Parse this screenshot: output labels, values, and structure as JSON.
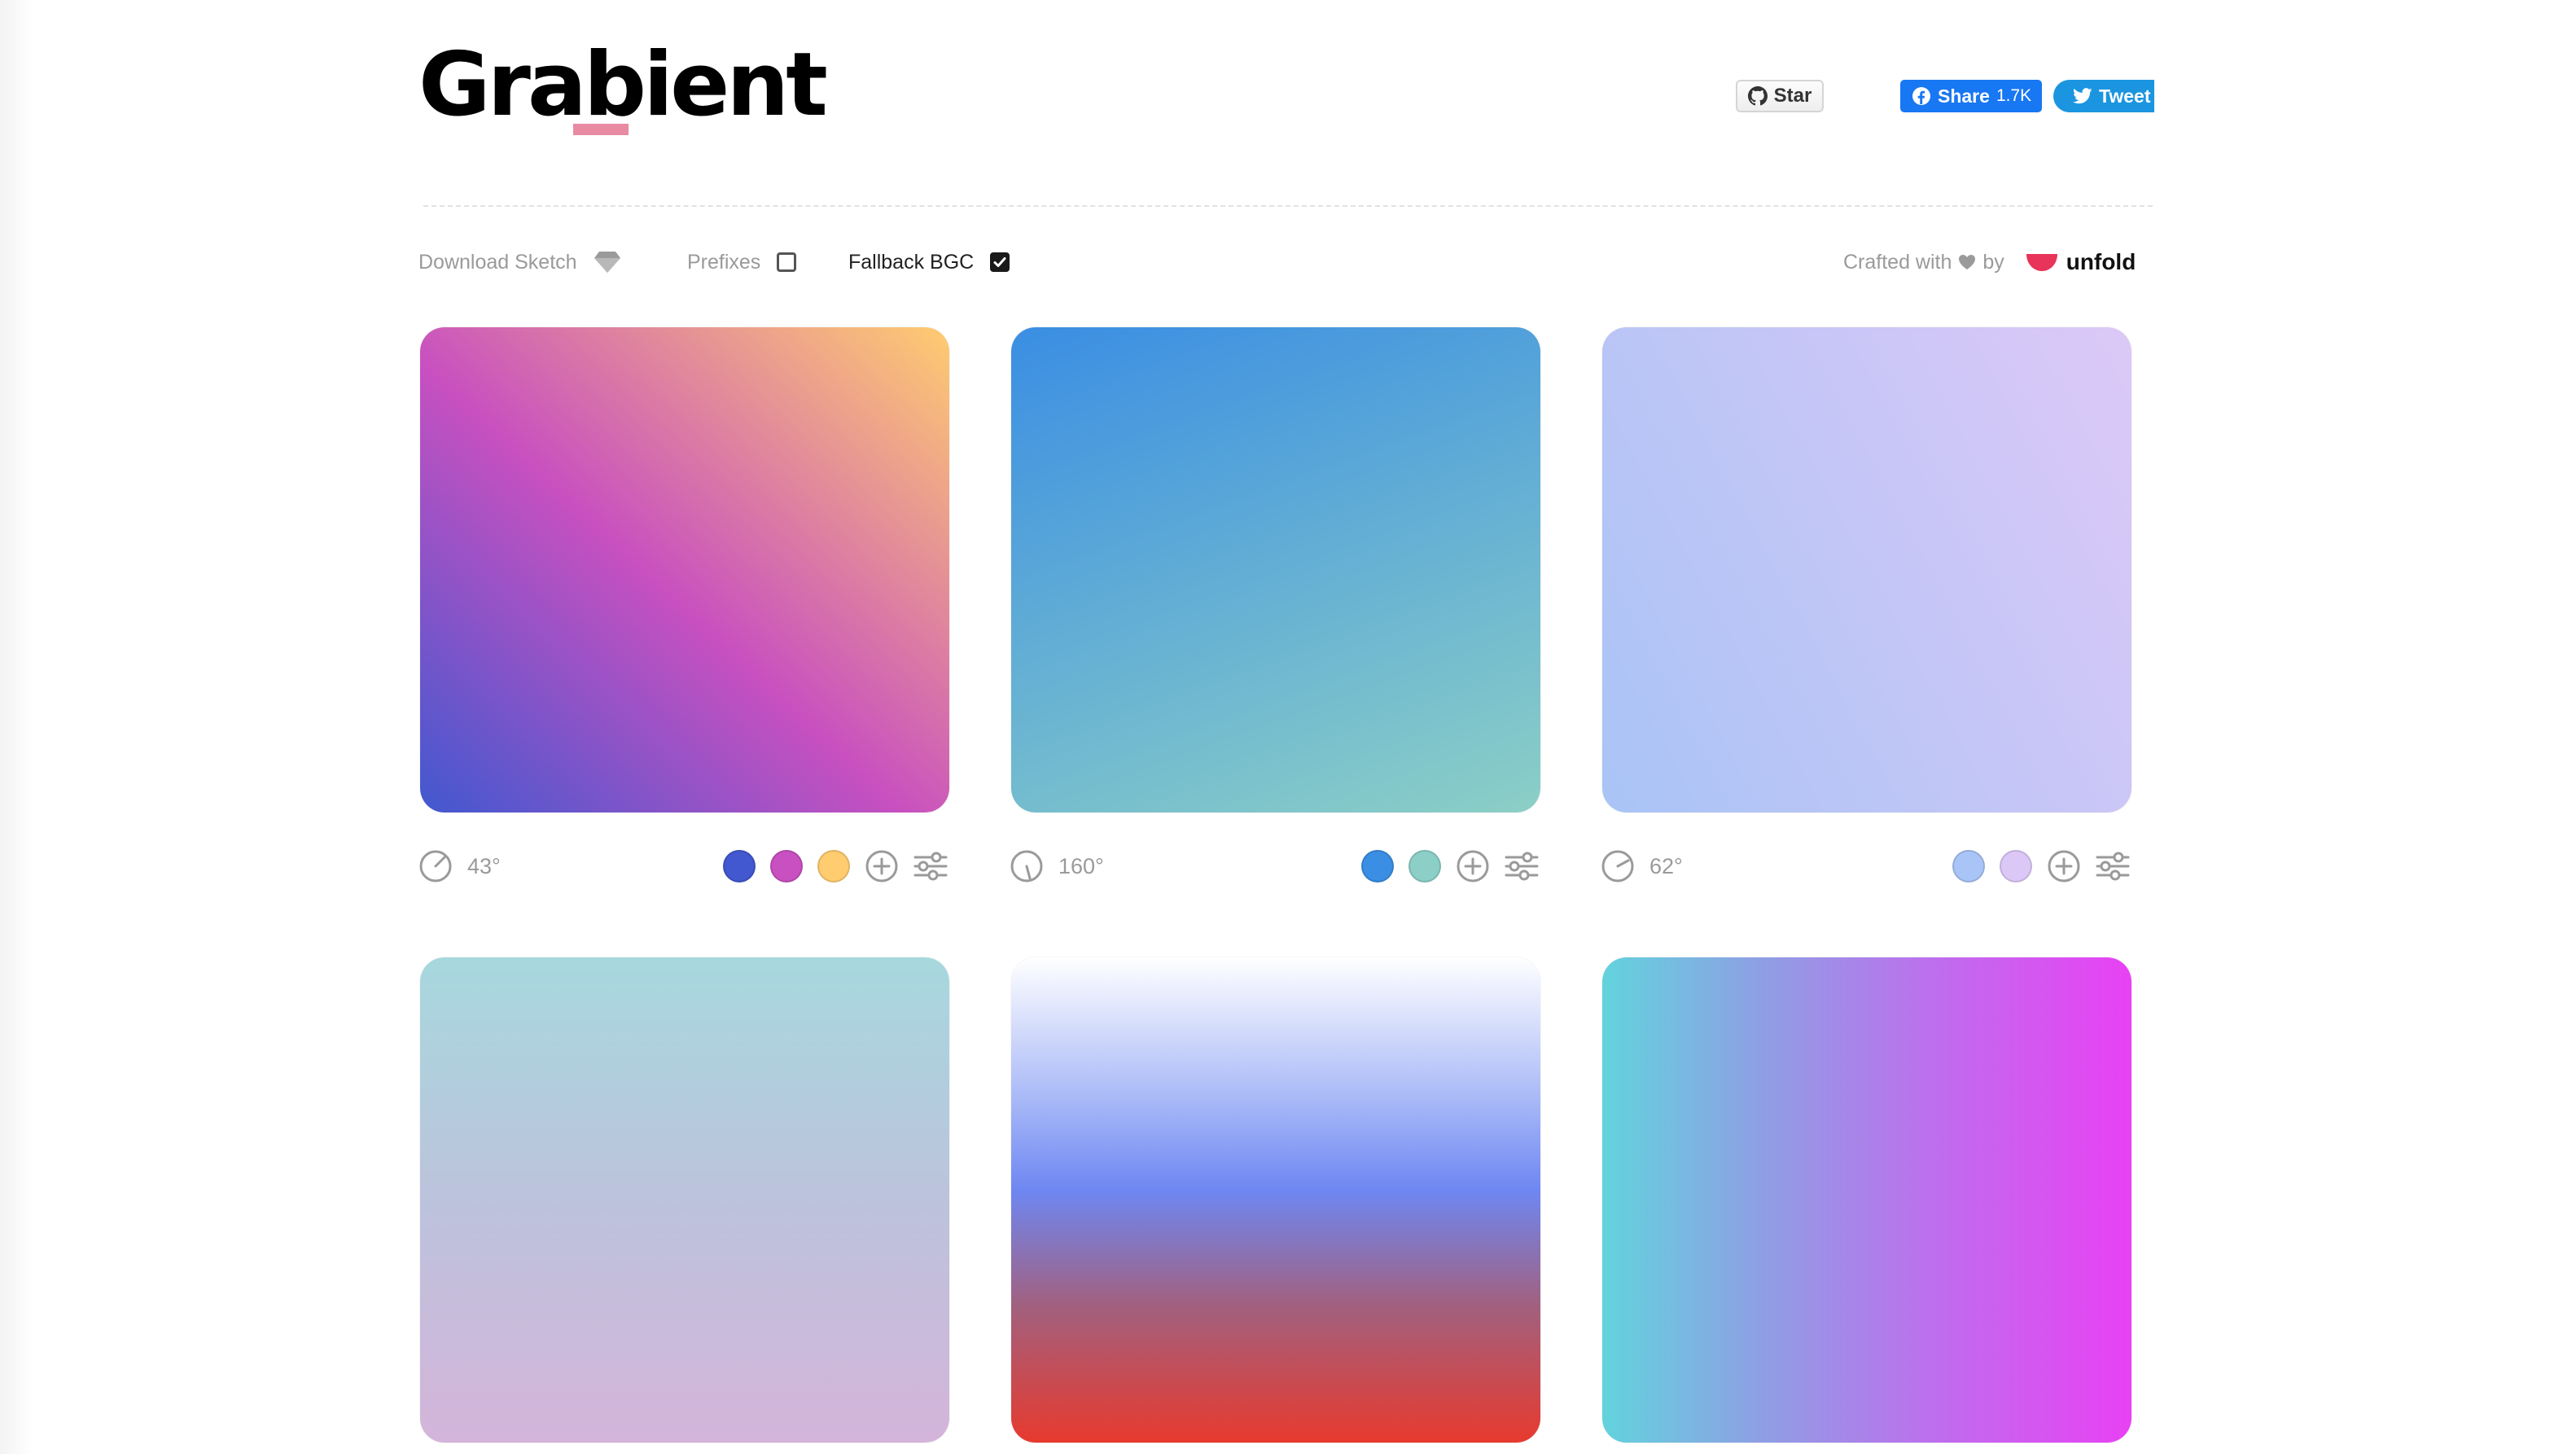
{
  "header": {
    "logo": "Grabient",
    "github_label": "Star",
    "facebook_label": "Share",
    "facebook_count": "1.7K",
    "twitter_label": "Tweet"
  },
  "toolbar": {
    "download_label": "Download Sketch",
    "prefixes_label": "Prefixes",
    "prefixes_checked": false,
    "fallback_label": "Fallback BGC",
    "fallback_checked": true,
    "crafted_label": "Crafted with",
    "by_label": "by",
    "brand_label": "unfold"
  },
  "colors": {
    "logo_accent": "#e98aa3",
    "facebook": "#1877f2",
    "twitter": "#1b95e0",
    "unfold_brand": "#e8335a"
  },
  "gradients": [
    {
      "angle": "43°",
      "stops": [
        "#4158D0",
        "#C850C0",
        "#FFCC70"
      ]
    },
    {
      "angle": "160°",
      "stops": [
        "#0093E9",
        "#80D0C7"
      ]
    },
    {
      "angle": "62°",
      "stops": [
        "#8EC5FC",
        "#E0C3FC"
      ]
    },
    {
      "angle": "",
      "stops": []
    },
    {
      "angle": "",
      "stops": []
    },
    {
      "angle": "",
      "stops": []
    }
  ]
}
